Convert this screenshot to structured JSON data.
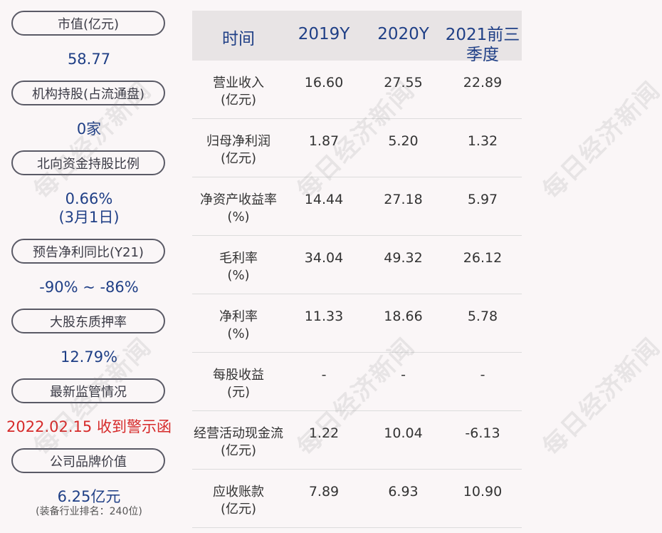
{
  "left": {
    "items": [
      {
        "label": "市值(亿元)",
        "value": "58.77"
      },
      {
        "label": "机构持股(占流通盘)",
        "value": "0家"
      },
      {
        "label": "北向资金持股比例",
        "value": "0.66%",
        "value2": "(3月1日)"
      },
      {
        "label": "预告净利同比(Y21)",
        "value": "-90% ~ -86%"
      },
      {
        "label": "大股东质押率",
        "value": "12.79%"
      },
      {
        "label": "最新监管情况",
        "value": "2022.02.15 收到警示函"
      },
      {
        "label": "公司品牌价值",
        "value": "6.25亿元",
        "sub": "(装备行业排名：240位)"
      }
    ]
  },
  "table": {
    "headers": [
      "时间",
      "2019Y",
      "2020Y",
      "2021前三季度"
    ],
    "rows": [
      {
        "label1": "营业收入",
        "label2": "(亿元)",
        "v": [
          "16.60",
          "27.55",
          "22.89"
        ]
      },
      {
        "label1": "归母净利润",
        "label2": "(亿元)",
        "v": [
          "1.87",
          "5.20",
          "1.32"
        ]
      },
      {
        "label1": "净资产收益率",
        "label2": "(%)",
        "v": [
          "14.44",
          "27.18",
          "5.97"
        ]
      },
      {
        "label1": "毛利率",
        "label2": "(%)",
        "v": [
          "34.04",
          "49.32",
          "26.12"
        ]
      },
      {
        "label1": "净利率",
        "label2": "(%)",
        "v": [
          "11.33",
          "18.66",
          "5.78"
        ]
      },
      {
        "label1": "每股收益",
        "label2": "(元)",
        "v": [
          "-",
          "-",
          "-"
        ]
      },
      {
        "label1": "经营活动现金流",
        "label2": "(亿元)",
        "v": [
          "1.22",
          "10.04",
          "-6.13"
        ]
      },
      {
        "label1": "应收账款",
        "label2": "(亿元)",
        "v": [
          "7.89",
          "6.93",
          "10.90"
        ]
      }
    ]
  },
  "watermark": "每日经济新闻",
  "colors": {
    "value_blue": "#1f3f86",
    "alert_red": "#d62a2a",
    "header_bg": "#e8e4e5"
  }
}
